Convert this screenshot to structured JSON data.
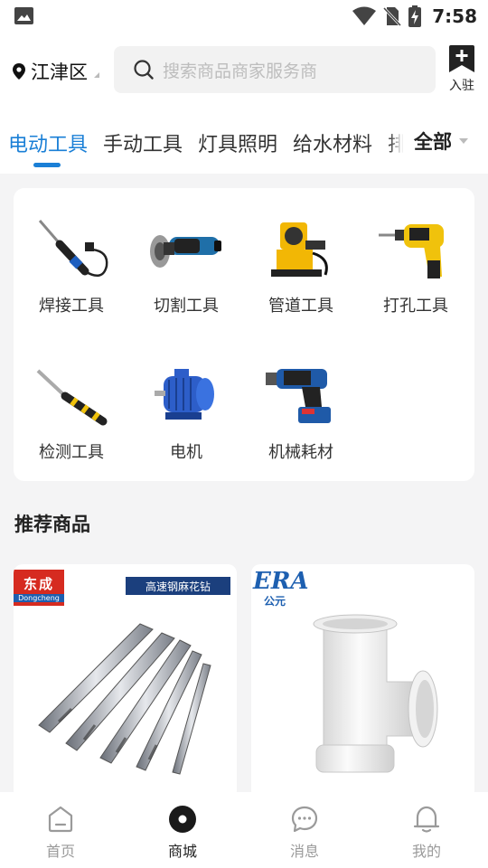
{
  "status_bar": {
    "time": "7:58",
    "icons": [
      "image-icon",
      "wifi-icon",
      "no-sim-icon",
      "battery-charging-icon"
    ]
  },
  "header": {
    "location": "江津区",
    "search_placeholder": "搜索商品商家服务商",
    "enter_label": "入驻"
  },
  "tabs": {
    "items": [
      {
        "label": "电动工具",
        "active": true
      },
      {
        "label": "手动工具",
        "active": false
      },
      {
        "label": "灯具照明",
        "active": false
      },
      {
        "label": "给水材料",
        "active": false
      },
      {
        "label": "排",
        "active": false
      }
    ],
    "all_label": "全部"
  },
  "categories": [
    {
      "label": "焊接工具",
      "icon": "soldering-iron-icon"
    },
    {
      "label": "切割工具",
      "icon": "angle-grinder-icon"
    },
    {
      "label": "管道工具",
      "icon": "pipe-cutter-icon"
    },
    {
      "label": "打孔工具",
      "icon": "drill-icon"
    },
    {
      "label": "检测工具",
      "icon": "test-pen-icon"
    },
    {
      "label": "电机",
      "icon": "electric-motor-icon"
    },
    {
      "label": "机械耗材",
      "icon": "hammer-drill-icon"
    }
  ],
  "recommended": {
    "title": "推荐商品",
    "products": [
      {
        "brand_cn": "东成",
        "brand_en": "Dongcheng",
        "tag": "高速钢麻花钻"
      },
      {
        "brand_en": "ERA",
        "brand_cn": "公元"
      }
    ]
  },
  "bottom_nav": [
    {
      "label": "首页",
      "icon": "home-icon",
      "active": false
    },
    {
      "label": "商城",
      "icon": "mall-icon",
      "active": true
    },
    {
      "label": "消息",
      "icon": "message-icon",
      "active": false
    },
    {
      "label": "我的",
      "icon": "profile-icon",
      "active": false
    }
  ],
  "colors": {
    "accent": "#1a7fd6",
    "background": "#f4f4f5"
  }
}
